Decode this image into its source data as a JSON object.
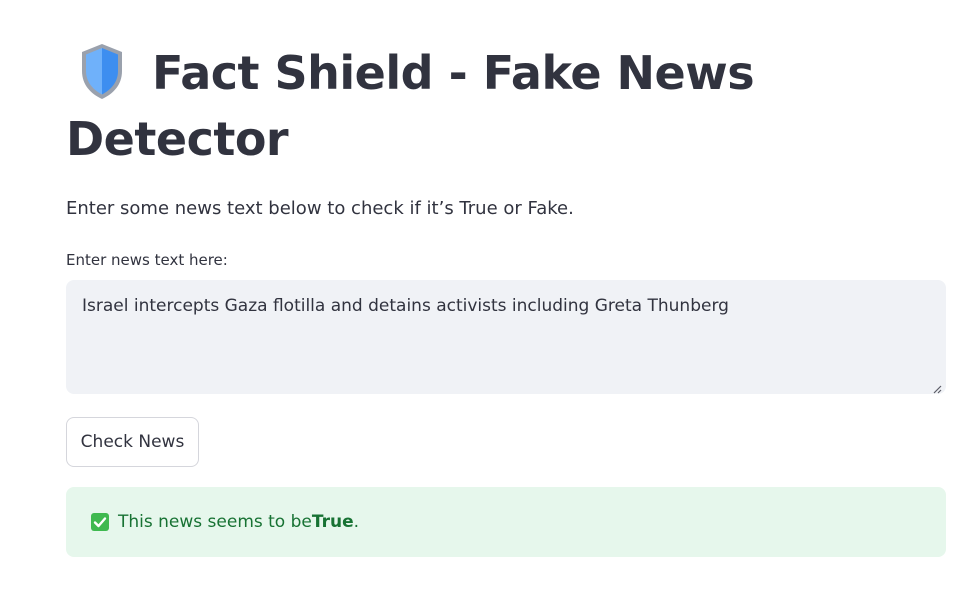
{
  "header": {
    "title": "Fact Shield - Fake News Detector",
    "icon": "shield-icon"
  },
  "intro": {
    "text": "Enter some news text below to check if it’s True or Fake."
  },
  "input": {
    "label": "Enter news text here:",
    "value": "Israel intercepts Gaza flotilla and detains activists including Greta Thunberg"
  },
  "actions": {
    "check_label": "Check News"
  },
  "result": {
    "icon": "check-mark-button-icon",
    "prefix": "This news seems to be ",
    "verdict": "True",
    "suffix": ".",
    "status_color": "#177233",
    "background_color": "#e6f7ec"
  }
}
